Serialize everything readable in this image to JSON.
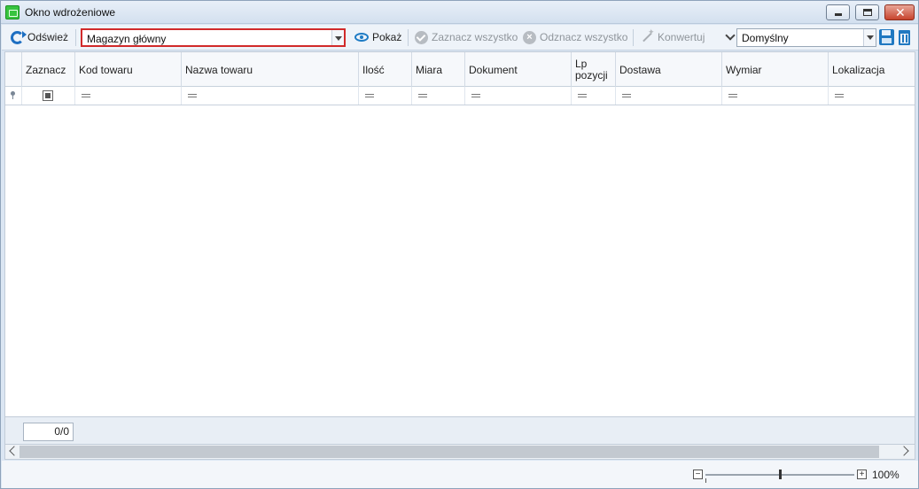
{
  "window": {
    "title": "Okno wdrożeniowe"
  },
  "toolbar": {
    "refresh_label": "Odśwież",
    "warehouse_value": "Magazyn główny",
    "show_label": "Pokaż",
    "select_all_label": "Zaznacz wszystko",
    "deselect_all_label": "Odznacz wszystko",
    "convert_label": "Konwertuj",
    "layout_value": "Domyślny"
  },
  "grid": {
    "columns": [
      "Zaznacz",
      "Kod towaru",
      "Nazwa towaru",
      "Ilość",
      "Miara",
      "Dokument",
      "Lp pozycji",
      "Dostawa",
      "Wymiar",
      "Lokalizacja"
    ]
  },
  "footer": {
    "counter": "0/0"
  },
  "status": {
    "zoom": "100%"
  },
  "colors": {
    "highlight_border": "#d12a2a",
    "accent": "#1f78c1"
  }
}
